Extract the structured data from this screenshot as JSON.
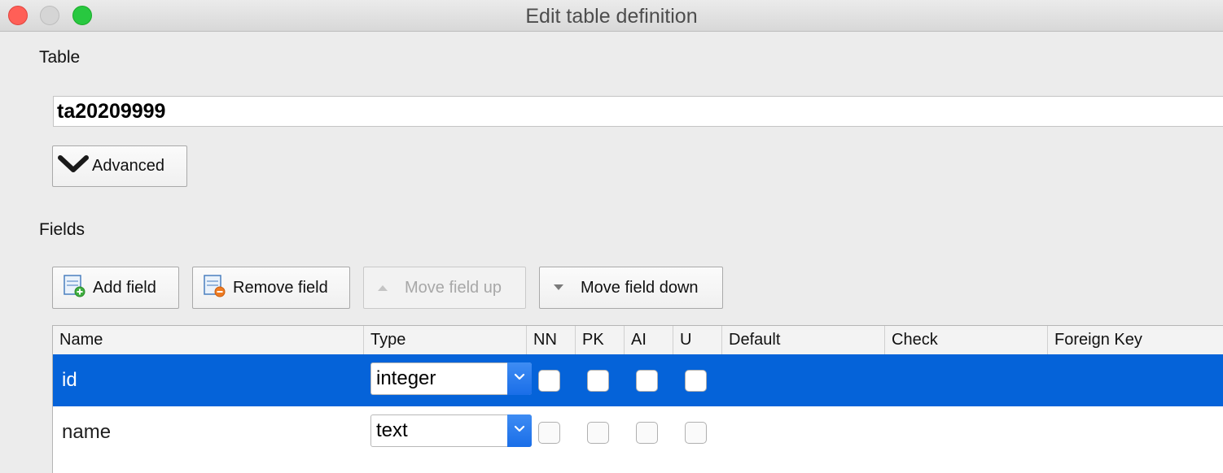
{
  "window": {
    "title": "Edit table definition",
    "traffic_lights": [
      "close",
      "minimize",
      "zoom"
    ]
  },
  "table_section": {
    "label": "Table",
    "name_value": "ta20209999",
    "advanced_button": "Advanced"
  },
  "fields_section": {
    "label": "Fields",
    "toolbar": {
      "add_field": "Add field",
      "remove_field": "Remove field",
      "move_up": "Move field up",
      "move_down": "Move field down"
    }
  },
  "grid": {
    "columns": [
      "Name",
      "Type",
      "NN",
      "PK",
      "AI",
      "U",
      "Default",
      "Check",
      "Foreign Key"
    ],
    "rows": [
      {
        "name": "id",
        "type": "integer",
        "nn": false,
        "pk": false,
        "ai": false,
        "u": false,
        "default": "",
        "check": "",
        "foreign_key": "",
        "selected": true
      },
      {
        "name": "name",
        "type": "text",
        "nn": false,
        "pk": false,
        "ai": false,
        "u": false,
        "default": "",
        "check": "",
        "foreign_key": "",
        "selected": false
      }
    ]
  },
  "colors": {
    "selection": "#0563d9",
    "select_arrow": "#1a6ee8",
    "close_light": "#ff5f57",
    "zoom_light": "#28c840"
  },
  "icons": {
    "advanced": "chevron-down-icon",
    "add_field": "add-field-icon",
    "remove_field": "remove-field-icon",
    "move_up": "triangle-up-icon",
    "move_down": "triangle-down-icon"
  }
}
